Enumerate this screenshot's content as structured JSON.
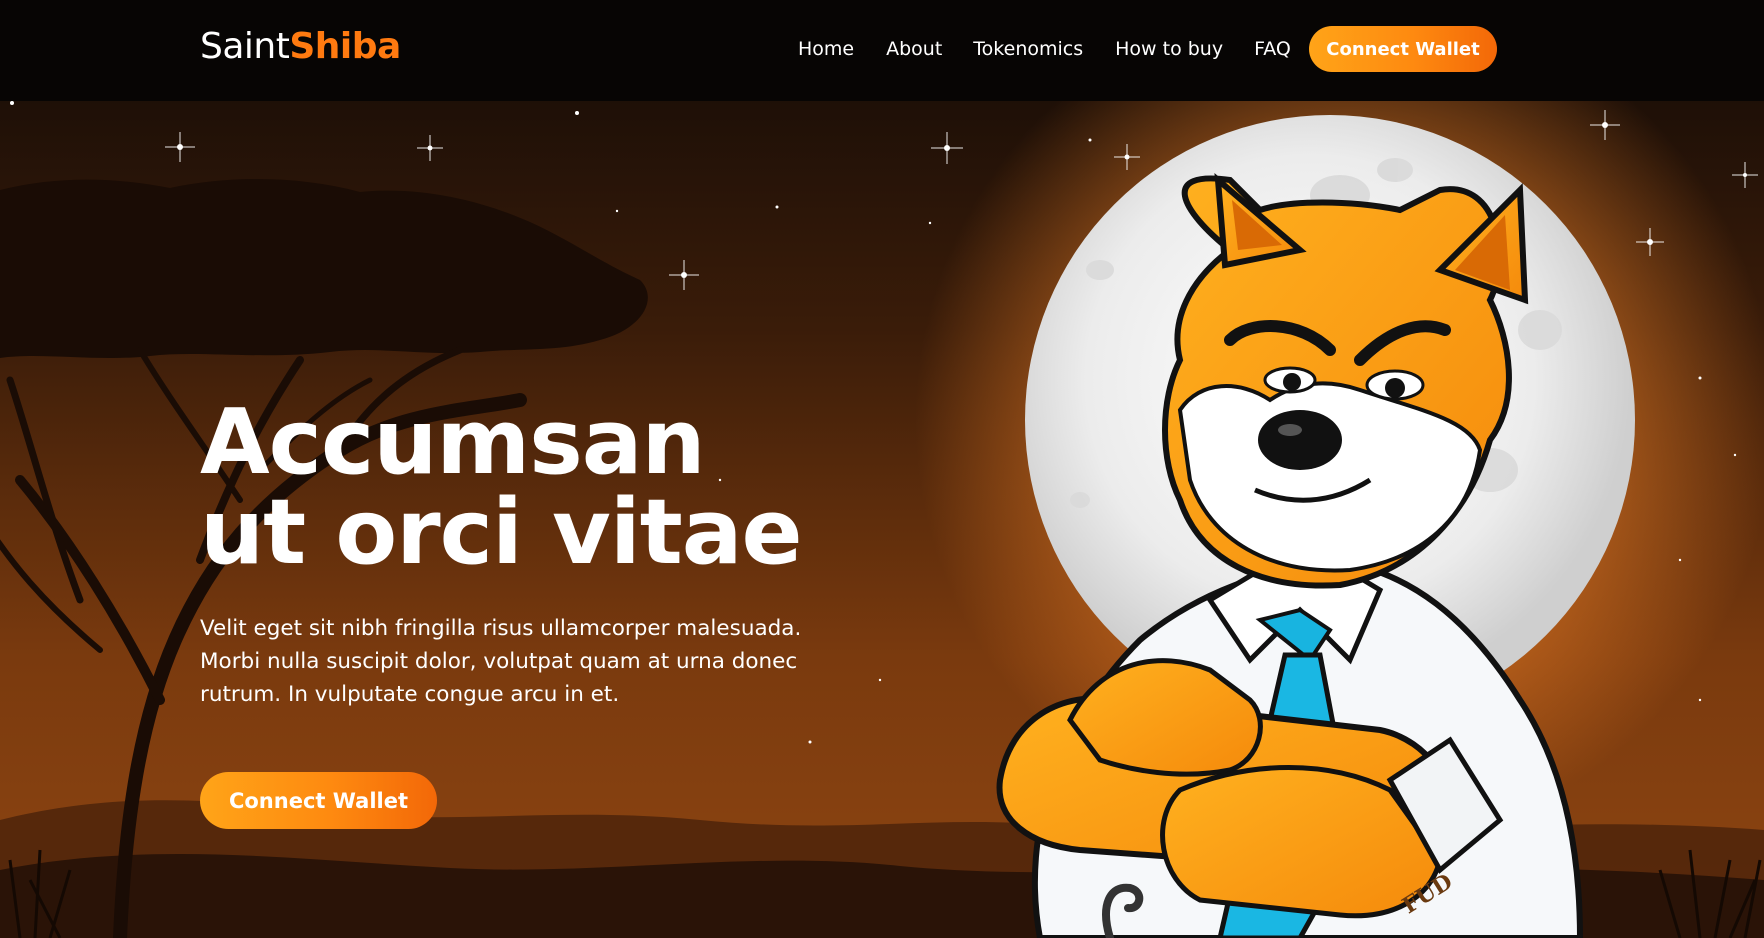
{
  "brand": {
    "name_part1": "Saint",
    "name_part2": "Shiba"
  },
  "nav": {
    "links": [
      "Home",
      "About",
      "Tokenomics",
      "How to buy",
      "FAQ"
    ],
    "cta_label": "Connect Wallet"
  },
  "hero": {
    "title_line1": "Accumsan",
    "title_line2": "ut orci vitae",
    "description": "Velit eget sit nibh fringilla risus ullamcorper malesuada. Morbi nulla suscipit dolor, volutpat quam at urna donec rutrum. In vulputate congue arcu in et.",
    "cta_label": "Connect Wallet",
    "mascot_tattoo": "FUD"
  },
  "colors": {
    "accent": "#ff7a10",
    "accent_light": "#ffa418",
    "navbar_bg": "#070504",
    "sky_bottom": "#8a4210",
    "tie": "#18b4e0"
  }
}
